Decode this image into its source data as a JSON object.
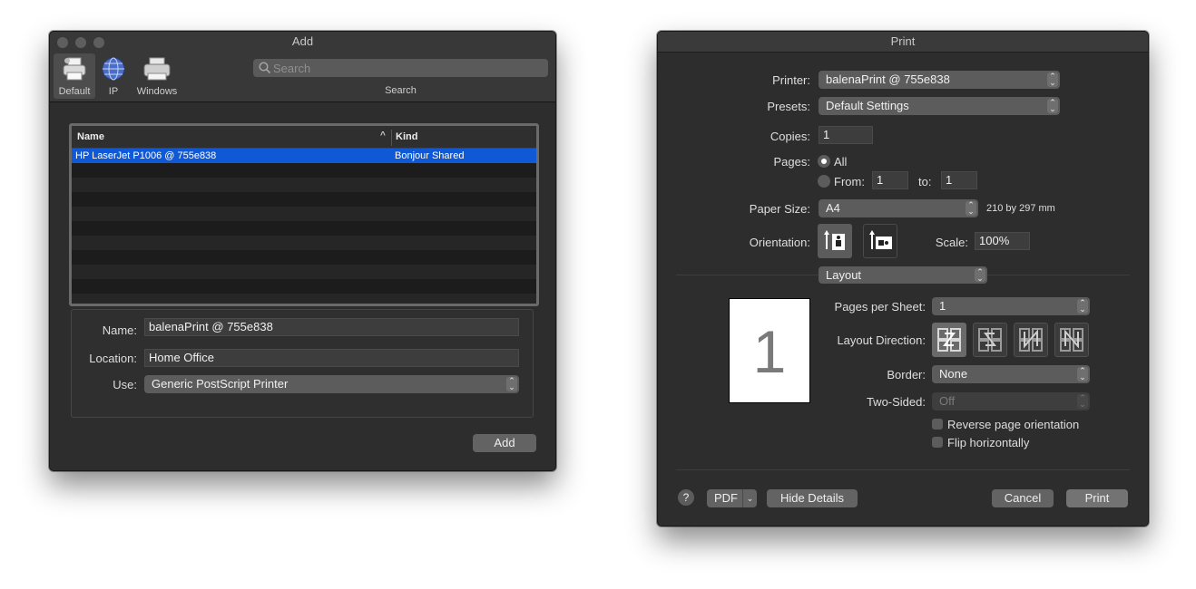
{
  "add_window": {
    "title": "Add",
    "toolbar": {
      "items": [
        {
          "label": "Default",
          "icon": "printer-default-icon"
        },
        {
          "label": "IP",
          "icon": "globe-icon"
        },
        {
          "label": "Windows",
          "icon": "printer-windows-icon"
        }
      ],
      "search_placeholder": "Search",
      "search_label": "Search"
    },
    "table": {
      "columns": [
        "Name",
        "Kind"
      ],
      "sort_indicator": "^",
      "rows": [
        {
          "name": "HP LaserJet P1006 @ 755e838",
          "kind": "Bonjour Shared",
          "selected": true
        }
      ]
    },
    "details": {
      "name_label": "Name:",
      "name_value": "balenaPrint @ 755e838",
      "location_label": "Location:",
      "location_value": "Home Office",
      "use_label": "Use:",
      "use_value": "Generic PostScript Printer"
    },
    "add_button": "Add"
  },
  "print_window": {
    "title": "Print",
    "printer_label": "Printer:",
    "printer_value": "balenaPrint @ 755e838",
    "presets_label": "Presets:",
    "presets_value": "Default Settings",
    "copies_label": "Copies:",
    "copies_value": "1",
    "pages_label": "Pages:",
    "pages_all": "All",
    "pages_from": "From:",
    "pages_from_value": "1",
    "pages_to": "to:",
    "pages_to_value": "1",
    "paper_size_label": "Paper Size:",
    "paper_size_value": "A4",
    "paper_dims": "210 by 297 mm",
    "orientation_label": "Orientation:",
    "scale_label": "Scale:",
    "scale_value": "100%",
    "section_popup": "Layout",
    "preview_page_number": "1",
    "pages_per_sheet_label": "Pages per Sheet:",
    "pages_per_sheet_value": "1",
    "layout_direction_label": "Layout Direction:",
    "border_label": "Border:",
    "border_value": "None",
    "two_sided_label": "Two-Sided:",
    "two_sided_value": "Off",
    "reverse_label": "Reverse page orientation",
    "flip_label": "Flip horizontally",
    "help_button": "?",
    "pdf_button": "PDF",
    "hide_details_button": "Hide Details",
    "cancel_button": "Cancel",
    "print_button": "Print"
  },
  "colors": {
    "window_bg": "#2d2d2d",
    "selection": "#0f59d6",
    "control": "#5c5c5c"
  }
}
